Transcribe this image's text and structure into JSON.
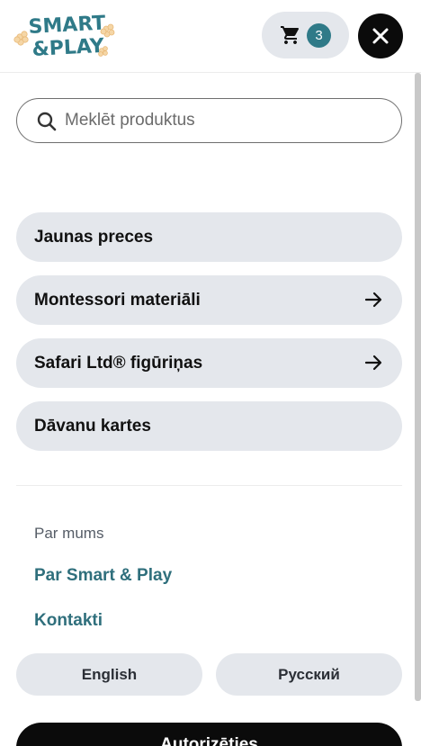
{
  "header": {
    "logo_line1": "SMART",
    "logo_line2": "&PLAY",
    "cart_count": "3",
    "cart_icon": "cart-icon",
    "close_icon": "close-icon"
  },
  "search": {
    "placeholder": "Meklēt produktus",
    "icon": "search-icon"
  },
  "nav": {
    "items": [
      {
        "label": "Jaunas preces",
        "has_arrow": false
      },
      {
        "label": "Montessori materiāli",
        "has_arrow": true
      },
      {
        "label": "Safari Ltd® figūriņas",
        "has_arrow": true
      },
      {
        "label": "Dāvanu kartes",
        "has_arrow": false
      }
    ]
  },
  "about": {
    "heading": "Par mums",
    "links": [
      "Par Smart & Play",
      "Kontakti"
    ]
  },
  "languages": [
    "English",
    "Русский"
  ],
  "auth_label": "Autorizēties",
  "colors": {
    "brand_teal": "#2f7a88",
    "link_teal": "#2f6f7c",
    "pill_grey": "#e4e7ec",
    "dark": "#0b0b0b",
    "logo_flower": "#f7d7a8"
  }
}
